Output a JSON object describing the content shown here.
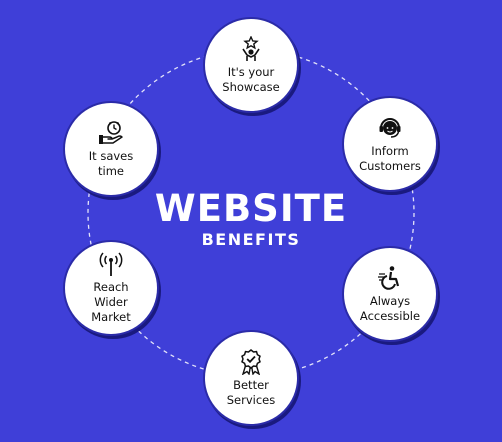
{
  "colors": {
    "background": "#3f3fd8",
    "node_fill": "#ffffff",
    "text": "#111111",
    "title": "#ffffff"
  },
  "center": {
    "title": "WEBSITE",
    "subtitle": "BENEFITS"
  },
  "nodes": [
    {
      "id": "showcase",
      "label": "It's your\nShowcase",
      "icon": "person-star-icon"
    },
    {
      "id": "inform",
      "label": "Inform\nCustomers",
      "icon": "headset-agent-icon"
    },
    {
      "id": "access",
      "label": "Always\nAccessible",
      "icon": "wheelchair-icon"
    },
    {
      "id": "better",
      "label": "Better\nServices",
      "icon": "award-badge-icon"
    },
    {
      "id": "reach",
      "label": "Reach\nWider\nMarket",
      "icon": "broadcast-tower-icon"
    },
    {
      "id": "saves",
      "label": "It saves\ntime",
      "icon": "hand-clock-icon"
    }
  ]
}
